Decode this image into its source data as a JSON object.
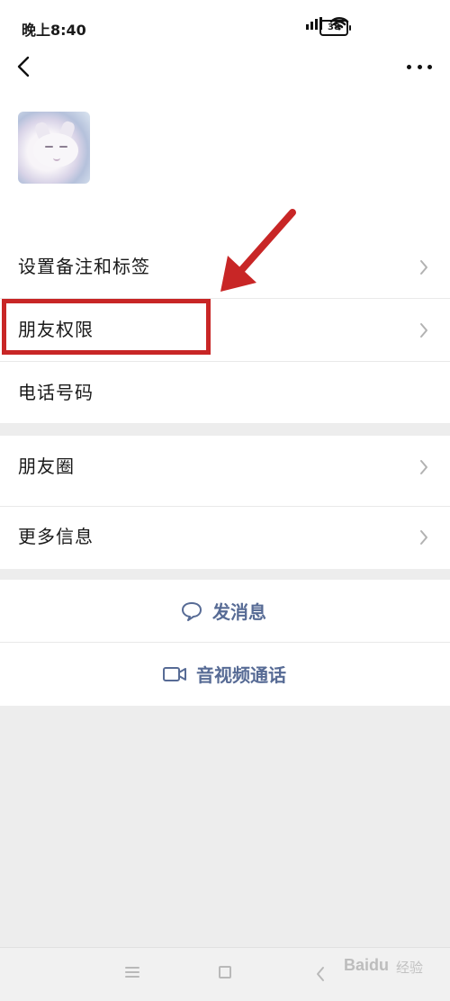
{
  "status_bar": {
    "time": "晚上8:40",
    "battery": "38"
  },
  "profile": {
    "avatar_alt": "avatar"
  },
  "menu": {
    "items": [
      {
        "label": "设置备注和标签"
      },
      {
        "label": "朋友权限"
      },
      {
        "label": "电话号码"
      },
      {
        "label": "朋友圈"
      },
      {
        "label": "更多信息"
      }
    ]
  },
  "actions": {
    "send_message": "发消息",
    "video_call": "音视频通话"
  },
  "watermark": {
    "brand": "Baidu",
    "suffix": "经验"
  },
  "colors": {
    "accent": "#576b95",
    "highlight": "#c82626"
  }
}
